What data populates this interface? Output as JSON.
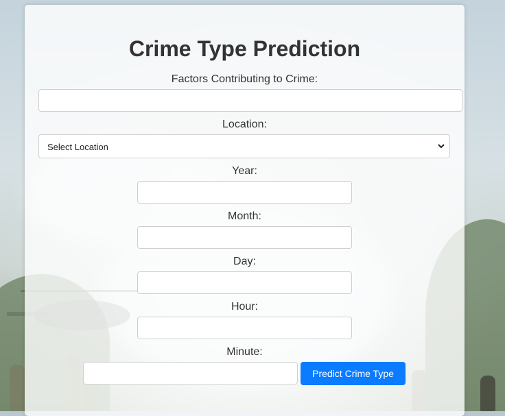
{
  "page": {
    "title": "Crime Type Prediction"
  },
  "form": {
    "factors": {
      "label": "Factors Contributing to Crime:",
      "value": "",
      "placeholder": ""
    },
    "location": {
      "label": "Location:",
      "selected": "Select Location"
    },
    "year": {
      "label": "Year:",
      "value": ""
    },
    "month": {
      "label": "Month:",
      "value": ""
    },
    "day": {
      "label": "Day:",
      "value": ""
    },
    "hour": {
      "label": "Hour:",
      "value": ""
    },
    "minute": {
      "label": "Minute:",
      "value": ""
    },
    "submit_label": "Predict Crime Type"
  },
  "icons": {
    "select_arrow": "chevron-down-icon"
  },
  "colors": {
    "accent": "#0b7bff",
    "title_text": "#333333"
  }
}
